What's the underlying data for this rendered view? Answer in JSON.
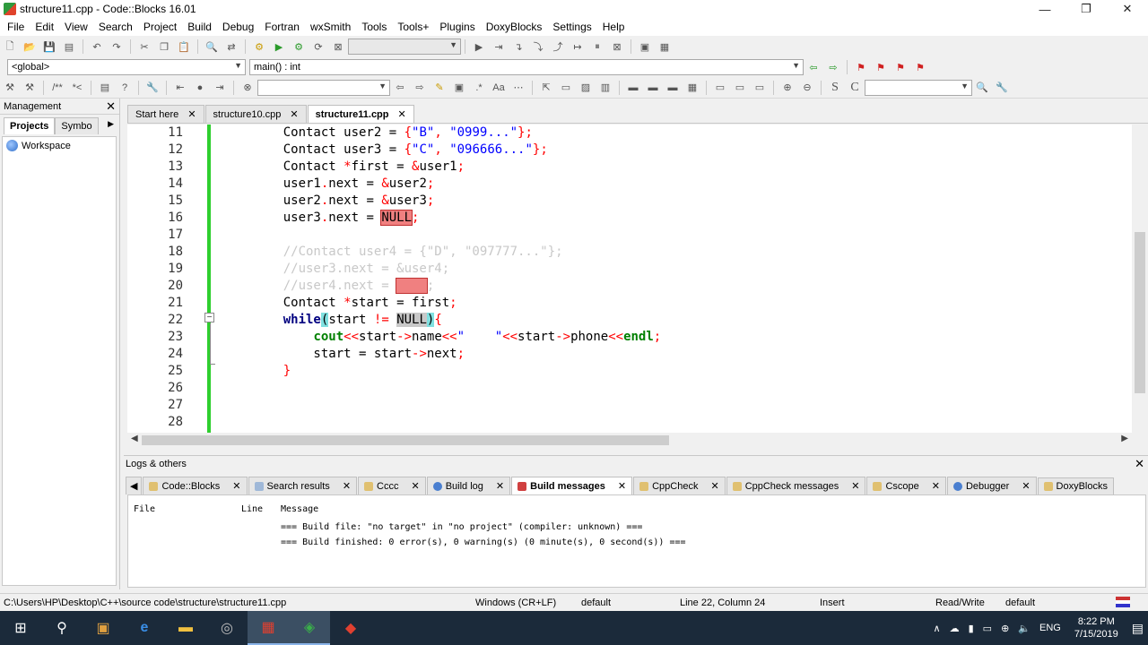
{
  "window": {
    "title": "structure11.cpp - Code::Blocks 16.01",
    "controls": [
      "—",
      "❐",
      "✕"
    ]
  },
  "menu": [
    "File",
    "Edit",
    "View",
    "Search",
    "Project",
    "Build",
    "Debug",
    "Fortran",
    "wxSmith",
    "Tools",
    "Tools+",
    "Plugins",
    "DoxyBlocks",
    "Settings",
    "Help"
  ],
  "toolbar": {
    "scope_combo": "<global>",
    "function_combo": "main() : int"
  },
  "management": {
    "title": "Management",
    "tabs": [
      "Projects",
      "Symbo"
    ],
    "workspace": "Workspace"
  },
  "editor": {
    "tabs": [
      "Start here",
      "structure10.cpp",
      "structure11.cpp"
    ],
    "active_tab": "structure11.cpp",
    "line_numbers": [
      "11",
      "12",
      "13",
      "14",
      "15",
      "16",
      "17",
      "18",
      "19",
      "20",
      "21",
      "22",
      "23",
      "24",
      "25",
      "26",
      "27",
      "28"
    ]
  },
  "logs": {
    "title": "Logs & others",
    "tabs": [
      "Code::Blocks",
      "Search results",
      "Cccc",
      "Build log",
      "Build messages",
      "CppCheck",
      "CppCheck messages",
      "Cscope",
      "Debugger",
      "DoxyBlocks"
    ],
    "columns": [
      "File",
      "Line",
      "Message"
    ],
    "messages": [
      "=== Build file: \"no target\" in \"no project\" (compiler: unknown) ===",
      "=== Build finished: 0 error(s), 0 warning(s) (0 minute(s), 0 second(s)) ==="
    ]
  },
  "status": {
    "path": "C:\\Users\\HP\\Desktop\\C++\\source code\\structure\\structure11.cpp",
    "eol": "Windows (CR+LF)",
    "encoding": "default",
    "position": "Line 22, Column 24",
    "mode": "Insert",
    "access": "Read/Write",
    "profile": "default"
  },
  "taskbar": {
    "lang": "ENG",
    "time": "8:22 PM",
    "date": "7/15/2019"
  }
}
